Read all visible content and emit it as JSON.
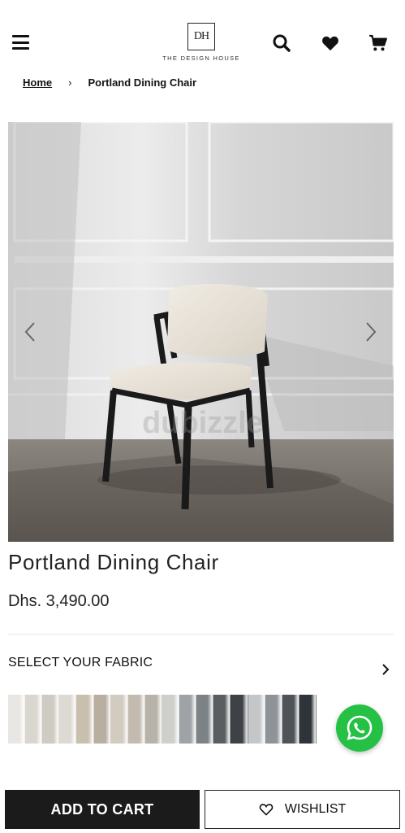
{
  "header": {
    "logo_mark": "DH",
    "logo_text": "THE DESIGN HOUSE",
    "icons": [
      "hamburger-menu-icon",
      "search-icon",
      "heart-icon",
      "cart-icon"
    ]
  },
  "breadcrumb": {
    "home": "Home",
    "separator": "›",
    "current": "Portland Dining Chair"
  },
  "gallery": {
    "watermark": "dubizzle",
    "prev_icon": "chevron-left-icon",
    "next_icon": "chevron-right-icon"
  },
  "product": {
    "title": "Portland Dining Chair",
    "price": "Dhs. 3,490.00"
  },
  "fabric": {
    "label": "SELECT YOUR FABRIC",
    "swatch_colors": [
      "#e9e7e3",
      "#d9d6d0",
      "#cfcac2",
      "#dddad3",
      "#c9bfae",
      "#b9aea2",
      "#d1cbc0",
      "#c3bbb0",
      "#b7b3aa",
      "#cfcfcc",
      "#9fa3a6",
      "#7d8286",
      "#5a5e61",
      "#3e4246",
      "#c4c6c7",
      "#8e9397",
      "#4e5358",
      "#2e343a"
    ]
  },
  "actions": {
    "add_to_cart": "ADD TO CART",
    "wishlist": "WISHLIST"
  },
  "colors": {
    "primary_button": "#1b1b1b",
    "whatsapp": "#25c145"
  }
}
